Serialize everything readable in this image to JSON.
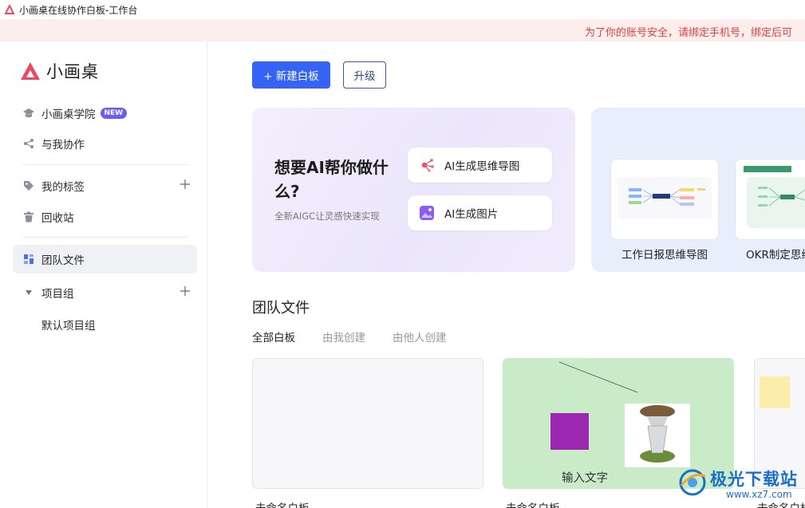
{
  "window": {
    "title": "小画桌在线协作白板-工作台"
  },
  "notice": {
    "text": "为了你的账号安全，请绑定手机号，绑定后可"
  },
  "sidebar": {
    "logo_text": "小画桌",
    "academy": {
      "label": "小画桌学院",
      "badge": "NEW"
    },
    "shared": {
      "label": "与我协作"
    },
    "tags": {
      "label": "我的标签"
    },
    "trash": {
      "label": "回收站"
    },
    "team_files": {
      "label": "团队文件"
    },
    "project_group": {
      "label": "项目组"
    },
    "default_group": {
      "label": "默认项目组"
    }
  },
  "toolbar": {
    "new_board": "+ 新建白板",
    "upgrade": "升级"
  },
  "ai_card": {
    "title": "想要AI帮你做什么?",
    "subtitle": "全新AIGC让灵感快速实现",
    "mindmap_button": "AI生成思维导图",
    "image_button": "AI生成图片"
  },
  "templates": [
    {
      "label": "工作日报思维导图"
    },
    {
      "label": "OKR制定思维"
    }
  ],
  "files_section": {
    "title": "团队文件",
    "tabs": [
      "全部白板",
      "由我创建",
      "由他人创建"
    ],
    "boards": [
      {
        "name": "未命名白板",
        "preview_text": ""
      },
      {
        "name": "未命名白板",
        "preview_text": "输入文字"
      },
      {
        "name": "未命名白板",
        "preview_text": ""
      }
    ]
  },
  "watermark": {
    "text": "极光下载站",
    "url": "www.xz7.com"
  },
  "colors": {
    "primary": "#3563f5",
    "brand_red": "#e84a5f",
    "badge": "#6b5cf3",
    "notice_bg": "#fdeeee",
    "notice_text": "#e04040"
  }
}
